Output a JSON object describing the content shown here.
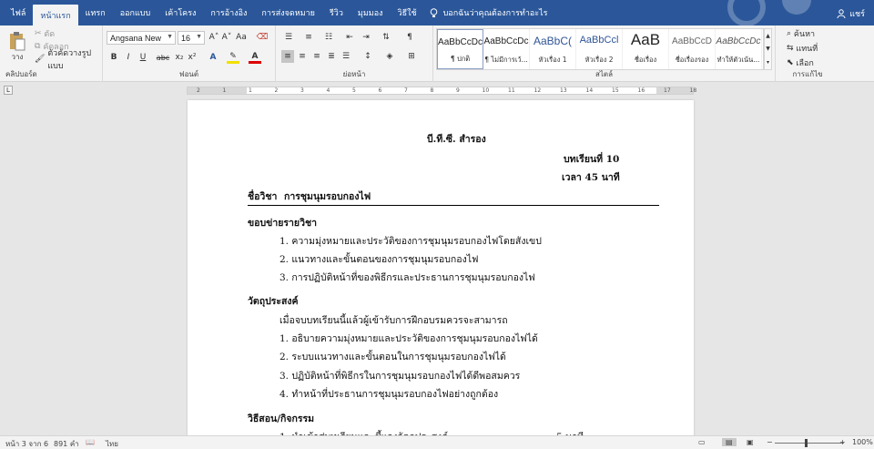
{
  "tabs": [
    "ไฟล์",
    "หน้าแรก",
    "แทรก",
    "ออกแบบ",
    "เค้าโครง",
    "การอ้างอิง",
    "การส่งจดหมาย",
    "รีวิว",
    "มุมมอง",
    "วิธีใช้"
  ],
  "tell_me": "บอกฉันว่าคุณต้องการทำอะไร",
  "user": "แชร์",
  "ribbon": {
    "paste": "วาง",
    "cut": "ตัด",
    "copy": "คัดลอก",
    "format_painter": "ตัวคัดวางรูปแบบ",
    "clipboard_label": "คลิปบอร์ด",
    "font_name": "Angsana New",
    "font_size": "16",
    "font_label": "ฟอนต์",
    "paragraph_label": "ย่อหน้า",
    "styles_label": "สไตล์",
    "editing_label": "การแก้ไข",
    "find": "ค้นหา",
    "replace": "แทนที่",
    "select": "เลือก",
    "grow": "A˄",
    "shrink": "A˅",
    "case": "Aa",
    "bold": "B",
    "italic": "I",
    "underline": "U",
    "strike": "abc",
    "sub": "x₂",
    "sup": "x²",
    "styles": [
      {
        "preview": "AaBbCcDc",
        "name": "¶ ปกติ"
      },
      {
        "preview": "AaBbCcDc",
        "name": "¶ ไม่มีการเว้..."
      },
      {
        "preview": "AaBbC(",
        "name": "หัวเรื่อง 1"
      },
      {
        "preview": "AaBbCcl",
        "name": "หัวเรื่อง 2"
      },
      {
        "preview": "AaB",
        "name": "ชื่อเรื่อง"
      },
      {
        "preview": "AaBbCcD",
        "name": "ชื่อเรื่องรอง"
      },
      {
        "preview": "AaBbCcDc",
        "name": "ทำให้ตัวเน้น..."
      }
    ]
  },
  "ruler_numbers": [
    "2",
    "1",
    "1",
    "2",
    "3",
    "4",
    "5",
    "6",
    "7",
    "8",
    "9",
    "10",
    "11",
    "12",
    "13",
    "14",
    "15",
    "16",
    "17",
    "18"
  ],
  "document": {
    "header": "บี.ที.ซี. สำรอง",
    "lesson": "บทเรียนที่ 10",
    "time": "เวลา 45 นาที",
    "subject_label": "ชื่อวิชา",
    "subject": "การชุมนุมรอบกองไฟ",
    "scope_title": "ขอบข่ายรายวิชา",
    "scope": [
      "1. ความมุ่งหมายและประวัติของการชุมนุมรอบกองไฟโดยสังเขป",
      "2. แนวทางและขั้นตอนของการชุมนุมรอบกองไฟ",
      "3. การปฏิบัติหน้าที่ของพิธีกรและประธานการชุมนุมรอบกองไฟ"
    ],
    "objective_title": "วัตถุประสงค์",
    "objective_intro": "เมื่อจบบทเรียนนี้แล้วผู้เข้ารับการฝึกอบรมควรจะสามารถ",
    "objectives": [
      "1. อธิบายความมุ่งหมายและประวัติของการชุมนุมรอบกองไฟได้",
      "2. ระบบแนวทางและขั้นตอนในการชุมนุมรอบกองไฟได้",
      "3. ปฏิบัติหน้าที่พิธีกรในการชุมนุมรอบกองไฟได้ดีพอสมควร",
      "4. ทำหน้าที่ประธานการชุมนุมรอบกองไฟอย่างถูกต้อง"
    ],
    "method_title": "วิธีสอน/กิจกรรม",
    "method_first": "1. นำเข้าสู่บทเรียนและชี้แจงวัตถุประสงค์",
    "method_first_time": "5 นาที"
  },
  "status": {
    "page": "หน้า 3 จาก 6",
    "words": "891 คำ",
    "lang": "ไทย",
    "zoom": "100%"
  },
  "colors": {
    "accent": "#2b579a"
  }
}
